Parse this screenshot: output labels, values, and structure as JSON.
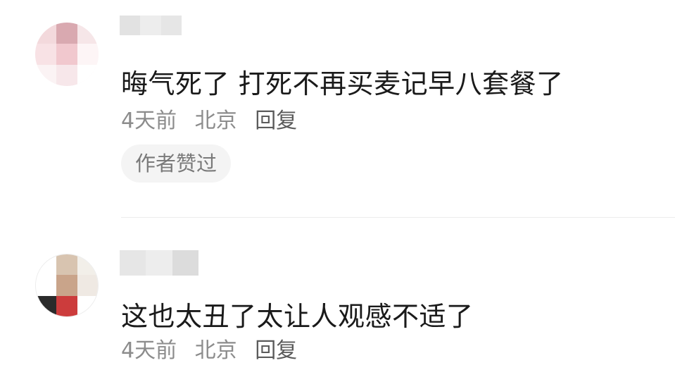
{
  "comments": [
    {
      "avatar_colors": [
        "#f3d9dc",
        "#d9a9b0",
        "#f6e6e8",
        "#f8e2e5",
        "#f1c8ce",
        "#fdf5f6",
        "#fbf3f4",
        "#f7e7ea",
        "#ffffff"
      ],
      "username_blur_colors": [
        "#e2e2e2",
        "#ededed",
        "#e6e6e6"
      ],
      "text": "晦气死了 打死不再买麦记早八套餐了",
      "time": "4天前",
      "location": "北京",
      "reply_label": "回复",
      "badge": "作者赞过"
    },
    {
      "avatar_colors": [
        "#ffffff",
        "#d8c4b0",
        "#f2efe9",
        "#ffffff",
        "#c9a48a",
        "#efe9e3",
        "#2b2b2b",
        "#cc3c3c",
        "#ffffff"
      ],
      "username_blur_colors": [
        "#e6e6e6",
        "#ededed",
        "#dcdcdc"
      ],
      "text": "这也太丑了太让人观感不适了",
      "time": "4天前",
      "location": "北京",
      "reply_label": "回复"
    }
  ]
}
